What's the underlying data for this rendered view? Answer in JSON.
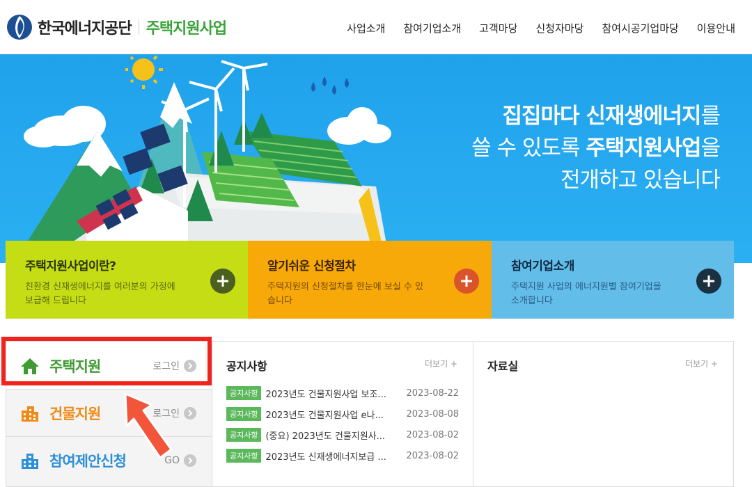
{
  "header": {
    "org": "한국에너지공단",
    "program": "주택지원사업",
    "nav": [
      "사업소개",
      "참여기업소개",
      "고객마당",
      "신청자마당",
      "참여시공기업마당",
      "이용안내"
    ]
  },
  "hero": {
    "line1_bold": "집집마다 신재생에너지",
    "line1_tail": "를",
    "line2_head": "쓸 수 있도록 ",
    "line2_bold": "주택지원사업",
    "line2_tail": "을",
    "line3": "전개하고 있습니다"
  },
  "quick_links": [
    {
      "title": "주택지원사업이란?",
      "desc": "친환경 신재생에너지를 여러분의 가정에 보급해 드립니다",
      "color": "#c5dd14"
    },
    {
      "title": "알기쉬운 신청절차",
      "desc": "주택지원의 신청절차를 한눈에 보실 수 있습니다",
      "color": "#f7a90a"
    },
    {
      "title": "참여기업소개",
      "desc": "주택지원 사업의 에너지원별 참여기업을 소개합니다",
      "color": "#62bde9"
    }
  ],
  "side_menu": [
    {
      "label": "주택지원",
      "action": "로그인",
      "icon": "house-icon"
    },
    {
      "label": "건물지원",
      "action": "로그인",
      "icon": "building-icon"
    },
    {
      "label": "참여제안신청",
      "action": "GO",
      "icon": "office-building-icon"
    }
  ],
  "notice": {
    "title": "공지사항",
    "more": "더보기 +",
    "items": [
      {
        "tag": "공지사항",
        "title": "2023년도 건물지원사업 보조...",
        "date": "2023-08-22"
      },
      {
        "tag": "공지사항",
        "title": "2023년도 건물지원사업 e나...",
        "date": "2023-08-08"
      },
      {
        "tag": "공지사항",
        "title": "(중요) 2023년도 건물지원사...",
        "date": "2023-08-02"
      },
      {
        "tag": "공지사항",
        "title": "2023년도 신재생에너지보급 ...",
        "date": "2023-08-02"
      }
    ]
  },
  "library": {
    "title": "자료실",
    "more": "더보기 +"
  },
  "colors": {
    "brand_green": "#3aa33a",
    "hero_blue": "#27aaf0",
    "highlight_red": "#f2231c",
    "annotation_arrow": "#f2553a"
  }
}
